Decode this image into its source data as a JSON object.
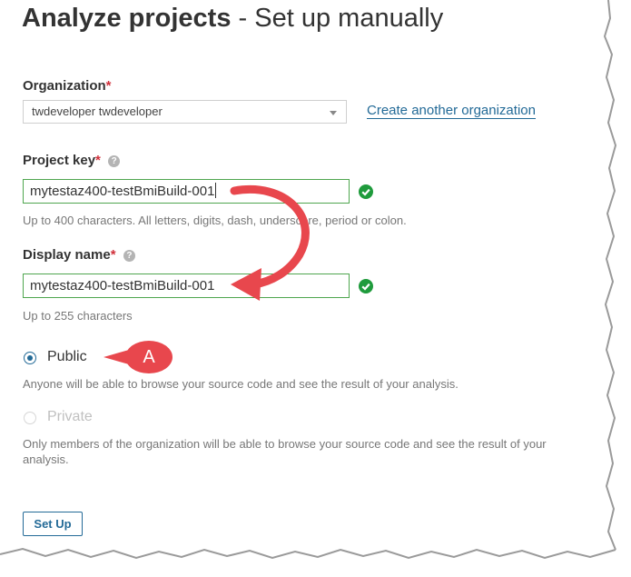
{
  "page": {
    "title_bold": "Analyze projects",
    "title_sep": " - ",
    "title_rest": "Set up manually"
  },
  "organization": {
    "label": "Organization",
    "required_mark": "*",
    "selected_value": "twdeveloper twdeveloper",
    "create_link": "Create another organization"
  },
  "project_key": {
    "label": "Project key",
    "required_mark": "*",
    "help_glyph": "?",
    "value": "mytestaz400-testBmiBuild-001",
    "hint": "Up to 400 characters. All letters, digits, dash, underscore, period or colon."
  },
  "display_name": {
    "label": "Display name",
    "required_mark": "*",
    "help_glyph": "?",
    "value": "mytestaz400-testBmiBuild-001",
    "hint": "Up to 255 characters"
  },
  "visibility": {
    "public_label": "Public",
    "public_selected": true,
    "public_desc": "Anyone will be able to browse your source code and see the result of your analysis.",
    "private_label": "Private",
    "private_enabled": false,
    "private_desc_line1": "Only members of the organization will be able to browse your source code and see the result of your",
    "private_desc_line2": "analysis."
  },
  "actions": {
    "setup_label": "Set Up"
  },
  "annotation": {
    "badge_text": "A"
  },
  "colors": {
    "accent": "#236a97",
    "valid": "#1f9b3c",
    "annotation": "#e8474d",
    "required": "#d02f3a"
  }
}
